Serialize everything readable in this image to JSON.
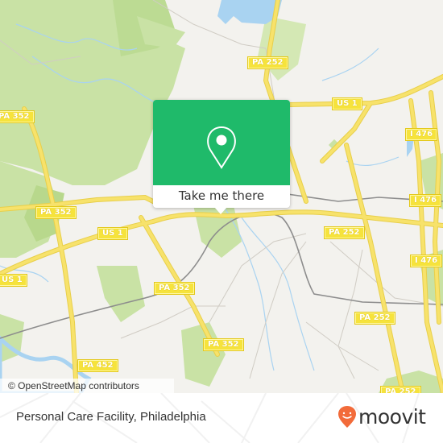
{
  "map": {
    "attribution": "© OpenStreetMap contributors",
    "road_shields": [
      {
        "id": "pa252-top",
        "label": "PA 252"
      },
      {
        "id": "pa352-left-top",
        "label": "PA 352"
      },
      {
        "id": "us1-right",
        "label": "US 1"
      },
      {
        "id": "i476-top",
        "label": "I 476"
      },
      {
        "id": "pa352-left-mid",
        "label": "PA 352"
      },
      {
        "id": "i476-mid",
        "label": "I 476"
      },
      {
        "id": "us1-center",
        "label": "US 1"
      },
      {
        "id": "pa252-mid",
        "label": "PA 252"
      },
      {
        "id": "i476-low",
        "label": "I 476"
      },
      {
        "id": "us1-left",
        "label": "US 1"
      },
      {
        "id": "pa352-center",
        "label": "PA 352"
      },
      {
        "id": "pa252-low",
        "label": "PA 252"
      },
      {
        "id": "pa352-low",
        "label": "PA 352"
      },
      {
        "id": "pa452",
        "label": "PA 452"
      },
      {
        "id": "pa252-bottom",
        "label": "PA 252"
      }
    ],
    "colors": {
      "land": "#f3f2ee",
      "forest": "#c9e2a5",
      "water": "#a9d3f1",
      "road_major": "#f7e26b",
      "shield": "#f6e33c"
    }
  },
  "popup": {
    "button_label": "Take me there",
    "icon": "location-pin-icon",
    "color": "#1fba6a"
  },
  "footer": {
    "place_name": "Personal Care Facility, Philadelphia",
    "brand": "moovit",
    "brand_color": "#f26b3a"
  }
}
